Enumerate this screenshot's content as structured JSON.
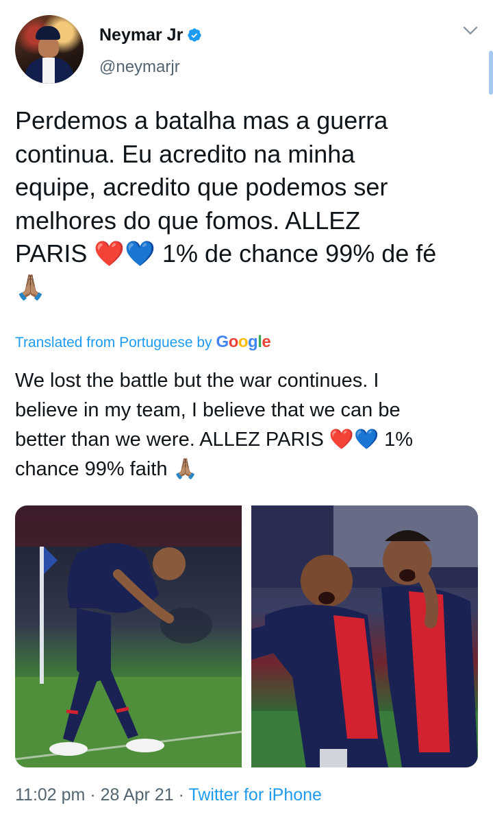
{
  "author": {
    "display_name": "Neymar Jr",
    "handle": "@neymarjr",
    "verified": true
  },
  "tweet": {
    "text": "Perdemos a batalha mas a guerra\ncontinua. Eu acredito na minha\nequipe, acredito que podemos ser\nmelhores do que fomos. ALLEZ\nPARIS ❤️💙 1% de chance 99% de fé\n🙏🏽",
    "translated_label": "Translated from Portuguese by",
    "translator_brand": "Google",
    "translation": "We lost the battle but the war continues. I\nbelieve in my team, I believe that we can be\nbetter than we were. ALLEZ PARIS ❤️💙 1%\nchance 99% faith 🙏🏽"
  },
  "meta": {
    "time": "11:02 pm",
    "separator": " · ",
    "date": "28 Apr 21",
    "source": "Twitter for iPhone"
  },
  "colors": {
    "link_blue": "#1d9bf0",
    "secondary_text": "#536471",
    "primary_text": "#0f1419",
    "psg_navy": "#1a2254",
    "psg_red": "#d3222f"
  },
  "icons": {
    "verified": "verified-badge-icon",
    "more": "chevron-down-icon"
  }
}
